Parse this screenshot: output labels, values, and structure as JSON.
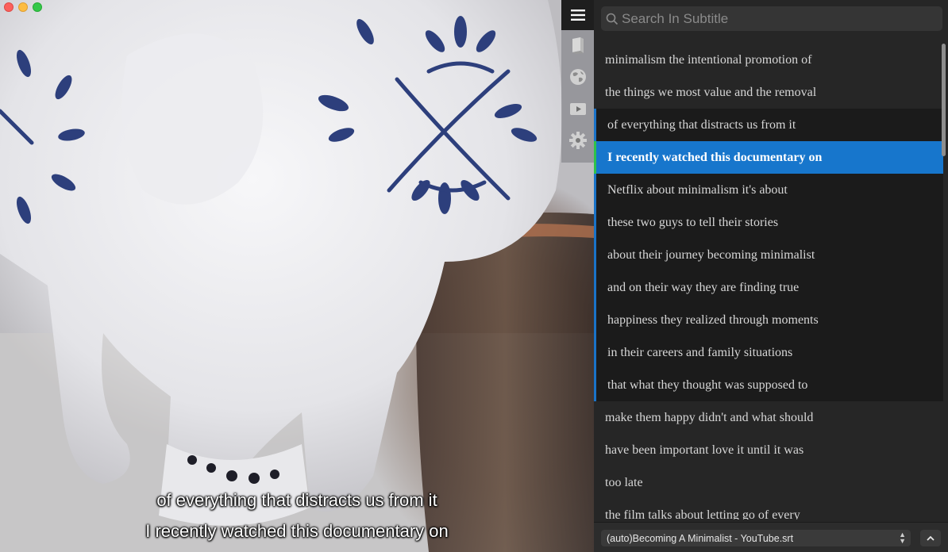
{
  "window": {
    "controls": [
      "close",
      "minimize",
      "maximize"
    ]
  },
  "video": {
    "overlay_subtitles": [
      "of everything that distracts us from it",
      "I recently watched this documentary on"
    ]
  },
  "toolbar": {
    "items": [
      {
        "icon": "menu-icon",
        "active": true
      },
      {
        "icon": "book-icon",
        "active": false
      },
      {
        "icon": "globe-icon",
        "active": false
      },
      {
        "icon": "video-icon",
        "active": false
      },
      {
        "icon": "gear-icon",
        "active": false
      }
    ]
  },
  "search": {
    "placeholder": "Search In Subtitle",
    "value": ""
  },
  "subtitles": [
    {
      "text": "minimalism the intentional promotion of",
      "state": "normal"
    },
    {
      "text": "the things we most value and the removal",
      "state": "normal"
    },
    {
      "text": "of everything that distracts us from it",
      "state": "in-window"
    },
    {
      "text": "I recently watched this documentary on",
      "state": "current"
    },
    {
      "text": "Netflix about minimalism it's about",
      "state": "in-window"
    },
    {
      "text": "these two guys to tell their stories",
      "state": "in-window"
    },
    {
      "text": "about their journey becoming minimalist",
      "state": "in-window"
    },
    {
      "text": "and on their way they are finding true",
      "state": "in-window"
    },
    {
      "text": "happiness they realized through moments",
      "state": "in-window"
    },
    {
      "text": "in their careers and family situations",
      "state": "in-window"
    },
    {
      "text": "that what they thought was supposed to",
      "state": "in-window"
    },
    {
      "text": "make them happy didn't and what should",
      "state": "normal"
    },
    {
      "text": "have been important love it until it was",
      "state": "normal"
    },
    {
      "text": "too late",
      "state": "normal"
    },
    {
      "text": "the film talks about letting go of every",
      "state": "normal"
    }
  ],
  "footer": {
    "selected_file": "(auto)Becoming A Minimalist - YouTube.srt"
  },
  "colors": {
    "current_row": "#1776cc",
    "current_marker": "#2ec24a",
    "window_marker": "#1a73c8",
    "panel_bg": "#262626"
  }
}
